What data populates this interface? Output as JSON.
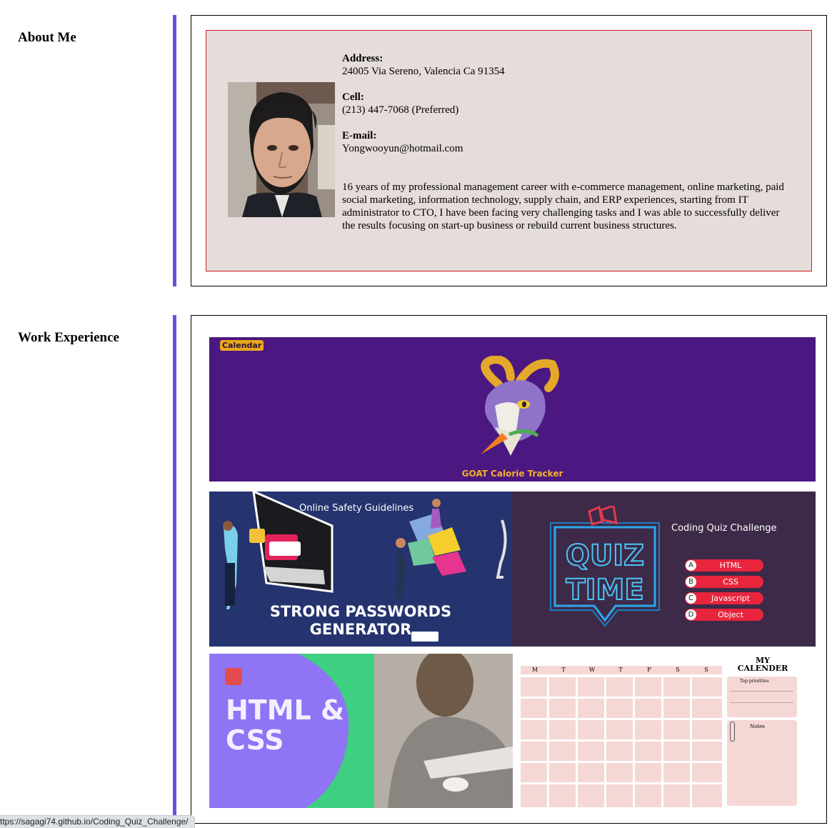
{
  "about": {
    "heading": "About Me",
    "address_label": "Address:",
    "address": "24005 Via Sereno, Valencia Ca 91354",
    "cell_label": "Cell:",
    "cell": "(213) 447-7068 (Preferred)",
    "email_label": "E-mail:",
    "email": "Yongwooyun@hotmail.com",
    "bio": "16 years of my professional management career with e-commerce management, online marketing, paid social marketing, information technology, supply chain, and ERP experiences, starting from IT administrator to CTO, I have been facing very challenging tasks and I was able to successfully deliver the results focusing on start-up business or rebuild current business structures."
  },
  "work": {
    "heading": "Work Experience",
    "calorie": {
      "badge": "Calendar",
      "title": "GOAT Calorie Tracker"
    },
    "passwords": {
      "subtitle": "Online Safety Guidelines",
      "title_line1": "STRONG PASSWORDS",
      "title_line2": "GENERATOR",
      "mask": "****"
    },
    "quiz": {
      "title": "Coding Quiz Challenge",
      "neon_line1": "QUIZ",
      "neon_line2": "TIME",
      "options": [
        {
          "letter": "A",
          "label": "HTML"
        },
        {
          "letter": "B",
          "label": "CSS"
        },
        {
          "letter": "C",
          "label": "Javascript"
        },
        {
          "letter": "D",
          "label": "Object"
        }
      ]
    },
    "html_css": {
      "title_line1": "HTML &",
      "title_line2": "CSS"
    },
    "calendar": {
      "days": [
        "M",
        "T",
        "W",
        "T",
        "F",
        "S",
        "S"
      ],
      "title_line1": "MY",
      "title_line2": "CALENDER",
      "top_label": "Top priorities",
      "notes_label": "Notes"
    }
  },
  "status_url": "ttps://sagagi74.github.io/Coding_Quiz_Challenge/",
  "colors": {
    "accent_bar": "#6c4ee0",
    "about_bg": "#e6dcdc",
    "about_border": "#d21f1f",
    "calorie_bg": "#4b1780",
    "passwords_bg": "#25336e",
    "quiz_bg": "#3d2a48",
    "htmlcss_green": "#3ecf80",
    "htmlcss_purple": "#8f74f5",
    "calendar_cell": "#f5d8d5"
  }
}
